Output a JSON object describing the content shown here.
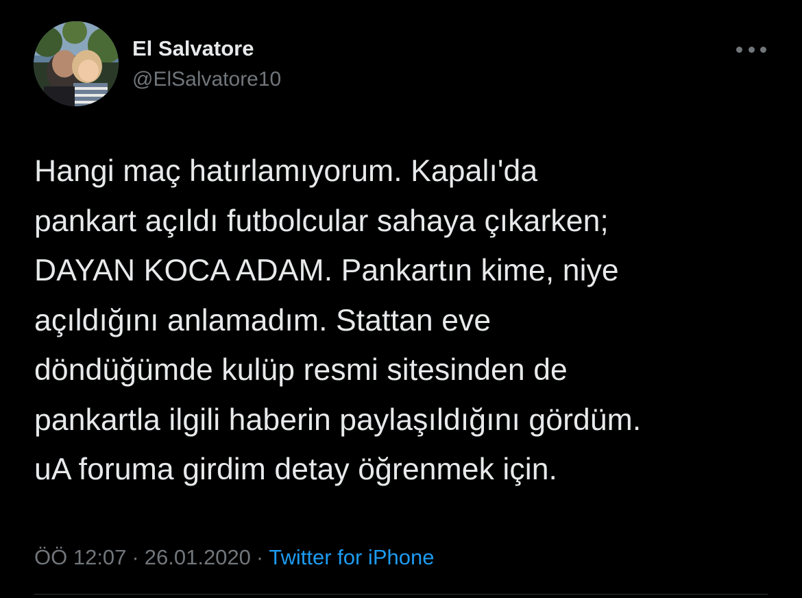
{
  "author": {
    "display_name": "El Salvatore",
    "handle": "@ElSalvatore10",
    "avatar_icon": "profile-photo"
  },
  "menu": {
    "more_icon": "more-horizontal-icon"
  },
  "tweet": {
    "lines": [
      "Hangi maç hatırlamıyorum. Kapalı'da",
      "pankart açıldı futbolcular sahaya çıkarken;",
      "DAYAN KOCA ADAM. Pankartın kime, niye",
      "açıldığını anlamadım. Stattan eve",
      "döndüğümde kulüp resmi sitesinden de",
      "pankartla ilgili haberin paylaşıldığını gördüm.",
      "uA foruma girdim detay öğrenmek için."
    ]
  },
  "meta": {
    "time": "ÖÖ 12:07",
    "separator": "·",
    "date": "26.01.2020",
    "source": "Twitter for iPhone"
  },
  "colors": {
    "background": "#000000",
    "text": "#e7e9ea",
    "secondary": "#71767b",
    "link": "#1d9bf0"
  }
}
